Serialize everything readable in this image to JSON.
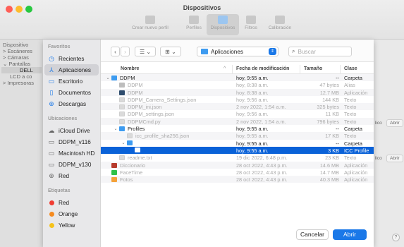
{
  "window": {
    "title": "Dispositivos",
    "toolbar": [
      {
        "label": "Crear nuevo perfil",
        "icon": "plus-icon"
      },
      {
        "label": "Perfiles",
        "icon": "folder-icon"
      },
      {
        "label": "Dispositivos",
        "icon": "monitor-icon"
      },
      {
        "label": "Filtros",
        "icon": "funnel-icon"
      },
      {
        "label": "Calibración",
        "icon": "calculator-icon"
      }
    ],
    "sidebar": {
      "heading": "Dispositivo",
      "items": [
        "> Escáneres",
        "> Cámaras",
        "⌄ Pantallas",
        "DELL",
        "LCD a co",
        "> Impresoras"
      ]
    },
    "abrir_1": "Abrir",
    "abrir_2": "Abrir",
    "partial_1": "lico",
    "partial_2": "lico",
    "help": "?"
  },
  "sheet": {
    "sidebar": {
      "favoritos_heading": "Favoritos",
      "favoritos": [
        {
          "label": "Recientes",
          "icon": "clock-icon"
        },
        {
          "label": "Aplicaciones",
          "icon": "apps-icon",
          "selected": true
        },
        {
          "label": "Escritorio",
          "icon": "desktop-icon"
        },
        {
          "label": "Documentos",
          "icon": "document-icon"
        },
        {
          "label": "Descargas",
          "icon": "download-icon"
        }
      ],
      "ubicaciones_heading": "Ubicaciones",
      "ubicaciones": [
        {
          "label": "iCloud Drive",
          "icon": "cloud-icon"
        },
        {
          "label": "DDPM_v116",
          "icon": "drive-icon"
        },
        {
          "label": "Macintosh HD",
          "icon": "drive-icon"
        },
        {
          "label": "DDPM_v130",
          "icon": "drive-icon"
        },
        {
          "label": "Red",
          "icon": "globe-icon"
        }
      ],
      "etiquetas_heading": "Etiquetas",
      "etiquetas": [
        {
          "label": "Red",
          "color": "#f03c32"
        },
        {
          "label": "Orange",
          "color": "#f58a1f"
        },
        {
          "label": "Yellow",
          "color": "#f5c21b"
        }
      ]
    },
    "toolbar": {
      "back": "‹",
      "forward": "›",
      "list_view": "☰ ⌄",
      "grid_view": "⊞ ⌄",
      "location": "Aplicaciones",
      "search_placeholder": "Buscar"
    },
    "columns": {
      "name": "Nombre",
      "modified": "Fecha de modificación",
      "size": "Tamaño",
      "kind": "Clase"
    },
    "rows": [
      {
        "indent": 0,
        "disc": "⌄",
        "icon": "folder",
        "name": "DDPM",
        "modified": "hoy, 9:55 a.m.",
        "size": "--",
        "kind": "Carpeta",
        "disabled": false
      },
      {
        "indent": 1,
        "disc": "",
        "icon": "alias",
        "name": "DDPM",
        "modified": "hoy, 8:38 a.m.",
        "size": "47 bytes",
        "kind": "Alias",
        "disabled": true
      },
      {
        "indent": 1,
        "disc": "",
        "icon": "app",
        "name": "DDPM",
        "modified": "hoy, 8:38 a.m.",
        "size": "12.7 MB",
        "kind": "Aplicación",
        "disabled": true
      },
      {
        "indent": 1,
        "disc": "",
        "icon": "doc",
        "name": "DDPM_Camera_Settings.json",
        "modified": "hoy, 9:56 a.m.",
        "size": "144 KB",
        "kind": "Texto",
        "disabled": true
      },
      {
        "indent": 1,
        "disc": "",
        "icon": "doc",
        "name": "DDPM_ini.json",
        "modified": "2 nov 2022, 1:54 a.m.",
        "size": "325 bytes",
        "kind": "Texto",
        "disabled": true
      },
      {
        "indent": 1,
        "disc": "",
        "icon": "doc",
        "name": "DDPM_settings.json",
        "modified": "hoy, 9:56 a.m.",
        "size": "11 KB",
        "kind": "Texto",
        "disabled": true
      },
      {
        "indent": 1,
        "disc": "",
        "icon": "doc",
        "name": "DDPMCmd.py",
        "modified": "2 nov 2022, 1:54 a.m.",
        "size": "796 bytes",
        "kind": "Texto",
        "disabled": true
      },
      {
        "indent": 1,
        "disc": "⌄",
        "icon": "folder",
        "name": "Profiles",
        "modified": "hoy, 9:55 a.m.",
        "size": "--",
        "kind": "Carpeta",
        "disabled": false
      },
      {
        "indent": 2,
        "disc": "",
        "icon": "doc",
        "name": "icc_profile_sha256.json",
        "modified": "hoy, 9:55 a.m.",
        "size": "17 KB",
        "kind": "Texto",
        "disabled": true
      },
      {
        "indent": 2,
        "disc": "⌄",
        "icon": "folder",
        "name": "",
        "modified": "hoy, 9:55 a.m.",
        "size": "--",
        "kind": "Carpeta",
        "disabled": false
      },
      {
        "indent": 3,
        "disc": "",
        "icon": "icc",
        "name": "",
        "modified": "hoy, 9:55 a.m.",
        "size": "3 KB",
        "kind": "ICC Profile",
        "disabled": false,
        "selected": true
      },
      {
        "indent": 1,
        "disc": "",
        "icon": "doc",
        "name": "readme.txt",
        "modified": "19 dic 2022, 6:48 p.m.",
        "size": "23 KB",
        "kind": "Texto",
        "disabled": true
      },
      {
        "indent": 0,
        "disc": "",
        "icon": "dict",
        "name": "Diccionario",
        "modified": "28 oct 2022, 4:43 p.m.",
        "size": "14.6 MB",
        "kind": "Aplicación",
        "disabled": true
      },
      {
        "indent": 0,
        "disc": "",
        "icon": "facetime",
        "name": "FaceTime",
        "modified": "28 oct 2022, 4:43 p.m.",
        "size": "14.7 MB",
        "kind": "Aplicación",
        "disabled": true
      },
      {
        "indent": 0,
        "disc": "",
        "icon": "photos",
        "name": "Fotos",
        "modified": "28 oct 2022, 4:43 p.m.",
        "size": "40.3 MB",
        "kind": "Aplicación",
        "disabled": true
      }
    ],
    "cancel": "Cancelar",
    "open": "Abrir"
  },
  "colors": {
    "accent": "#1a78e8",
    "selection": "#0a62d8"
  }
}
